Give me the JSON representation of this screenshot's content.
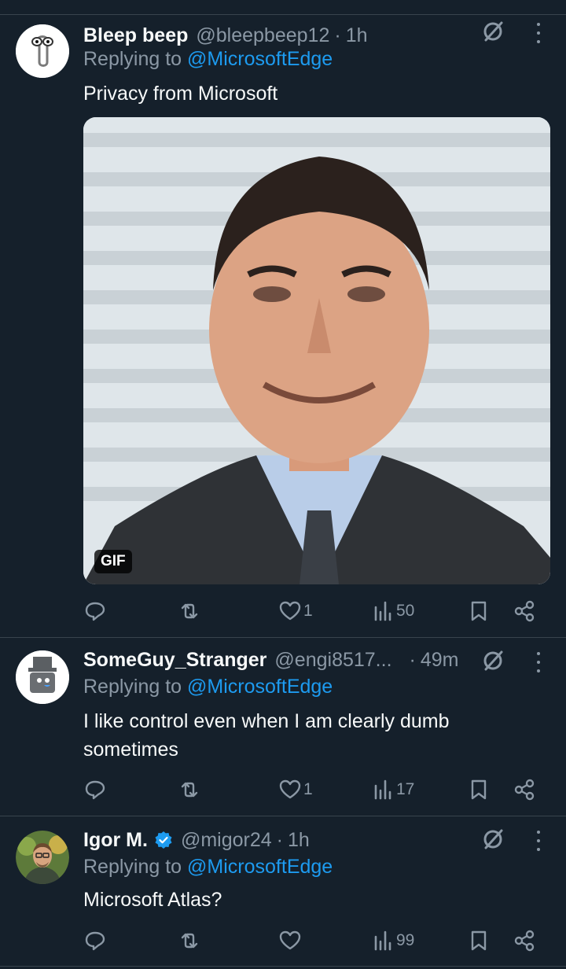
{
  "tweets": [
    {
      "name": "Bleep beep",
      "handle": "@bleepbeep12",
      "dot": "·",
      "time": "1h",
      "replying_prefix": "Replying to",
      "replying_to": "@MicrosoftEdge",
      "text": "Privacy from Microsoft",
      "media": {
        "badge": "GIF"
      },
      "stats": {
        "replies": "",
        "retweets": "",
        "likes": "1",
        "views": "50"
      }
    },
    {
      "name": "SomeGuy_Stranger",
      "handle": "@engi8517...",
      "dot": "·",
      "time": "49m",
      "replying_prefix": "Replying to",
      "replying_to": "@MicrosoftEdge",
      "text": "I like control even when I am clearly dumb sometimes",
      "stats": {
        "replies": "",
        "retweets": "",
        "likes": "1",
        "views": "17"
      }
    },
    {
      "name": "Igor M.",
      "handle": "@migor24",
      "dot": "·",
      "time": "1h",
      "replying_prefix": "Replying to",
      "replying_to": "@MicrosoftEdge",
      "text": "Microsoft Atlas?",
      "stats": {
        "replies": "",
        "retweets": "",
        "likes": "",
        "views": "99"
      }
    }
  ],
  "colors": {
    "background": "#15202b",
    "accent": "#1d9bf0",
    "muted": "#8b98a5",
    "divider": "#38444d"
  },
  "icons": [
    "grok-icon",
    "more-icon",
    "reply-icon",
    "retweet-icon",
    "like-icon",
    "views-icon",
    "bookmark-icon",
    "share-icon",
    "verified-badge-icon"
  ]
}
